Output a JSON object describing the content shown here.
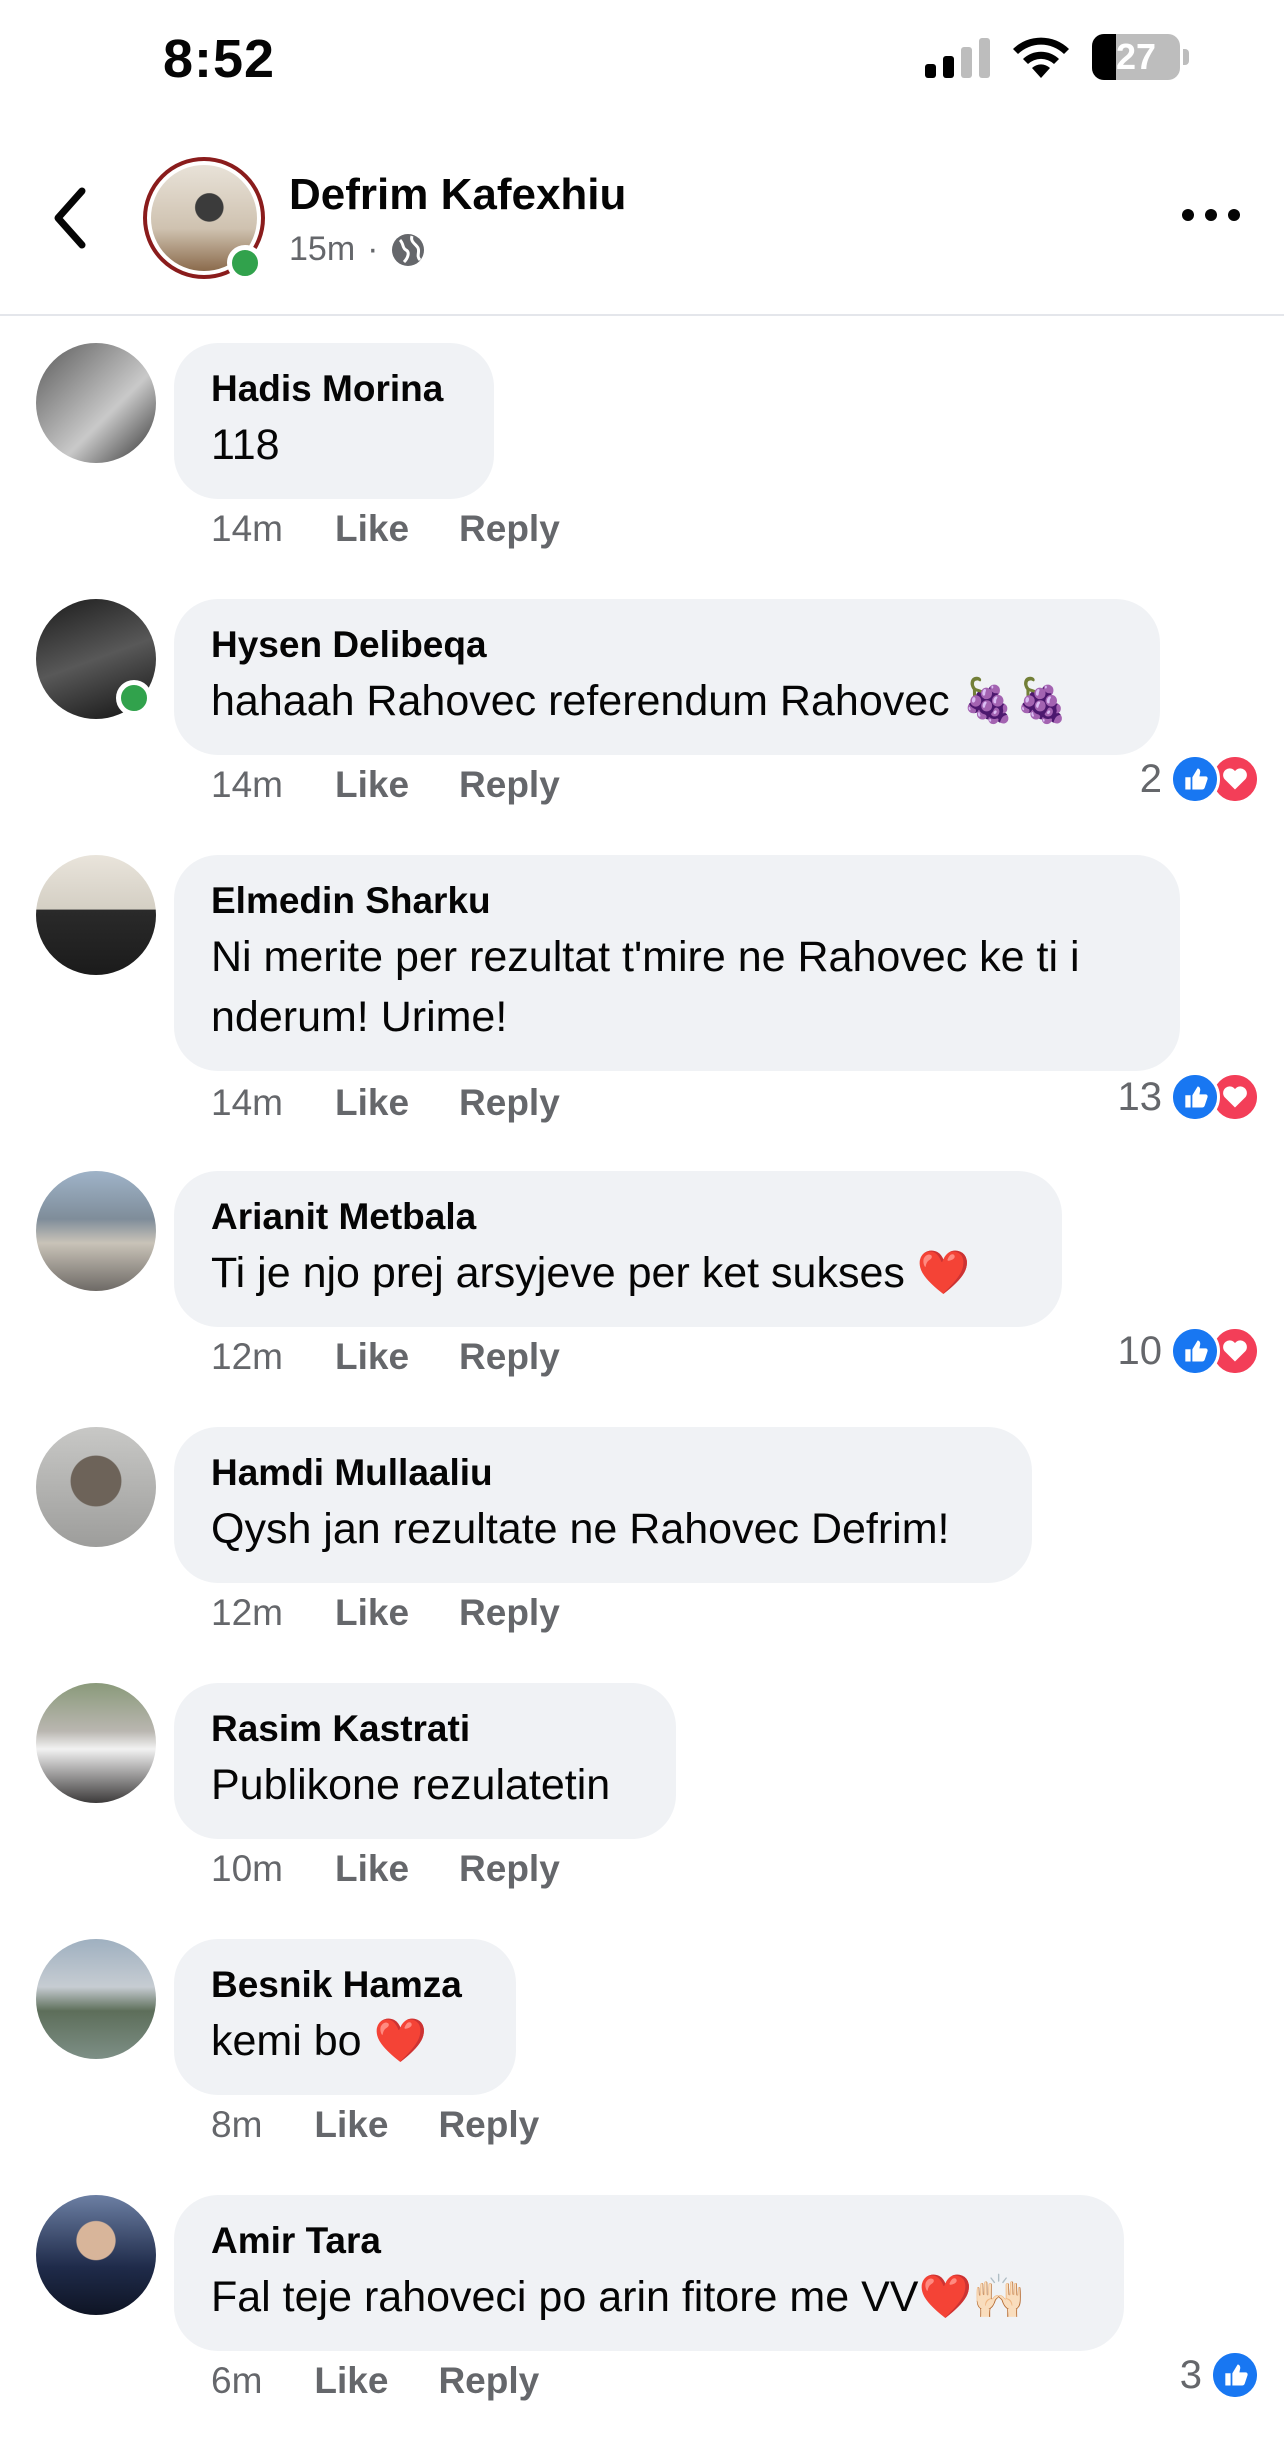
{
  "status_bar": {
    "time": "8:52",
    "battery": "27",
    "battery_level": 0.27
  },
  "header": {
    "name": "Defrim Kafexhiu",
    "time": "15m",
    "separator": "·"
  },
  "comments": [
    {
      "name": "Hadis Morina",
      "text": "118",
      "time": "14m",
      "like": "Like",
      "reply": "Reply",
      "reactions": null,
      "online": false
    },
    {
      "name": "Hysen Delibeqa",
      "text": "hahaah Rahovec referendum Rahovec 🍇🍇",
      "time": "14m",
      "like": "Like",
      "reply": "Reply",
      "reactions": {
        "count": "2",
        "types": [
          "like",
          "love"
        ]
      },
      "online": true
    },
    {
      "name": "Elmedin Sharku",
      "text": "Ni merite per rezultat t'mire ne Rahovec ke ti i nderum! Urime!",
      "time": "14m",
      "like": "Like",
      "reply": "Reply",
      "reactions": {
        "count": "13",
        "types": [
          "like",
          "love"
        ]
      },
      "online": false
    },
    {
      "name": "Arianit Metbala",
      "text": "Ti je njo prej arsyjeve per ket sukses ❤️",
      "time": "12m",
      "like": "Like",
      "reply": "Reply",
      "reactions": {
        "count": "10",
        "types": [
          "like",
          "love"
        ]
      },
      "online": false
    },
    {
      "name": "Hamdi Mullaaliu",
      "text": "Qysh jan rezultate ne Rahovec Defrim!",
      "time": "12m",
      "like": "Like",
      "reply": "Reply",
      "reactions": null,
      "online": false
    },
    {
      "name": "Rasim Kastrati",
      "text": "Publikone rezulatetin",
      "time": "10m",
      "like": "Like",
      "reply": "Reply",
      "reactions": null,
      "online": false
    },
    {
      "name": "Besnik Hamza",
      "text": "kemi bo ❤️",
      "time": "8m",
      "like": "Like",
      "reply": "Reply",
      "reactions": null,
      "online": false
    },
    {
      "name": "Amir Tara",
      "text": "Fal teje rahoveci po arin fitore me VV❤️🙌🏻",
      "time": "6m",
      "like": "Like",
      "reply": "Reply",
      "reactions": {
        "count": "3",
        "types": [
          "like"
        ]
      },
      "online": false
    }
  ],
  "colors": {
    "like": "#1877f2",
    "love": "#f33e58",
    "online": "#31a24c",
    "bubble": "#f0f2f5",
    "muted": "#65676b"
  }
}
